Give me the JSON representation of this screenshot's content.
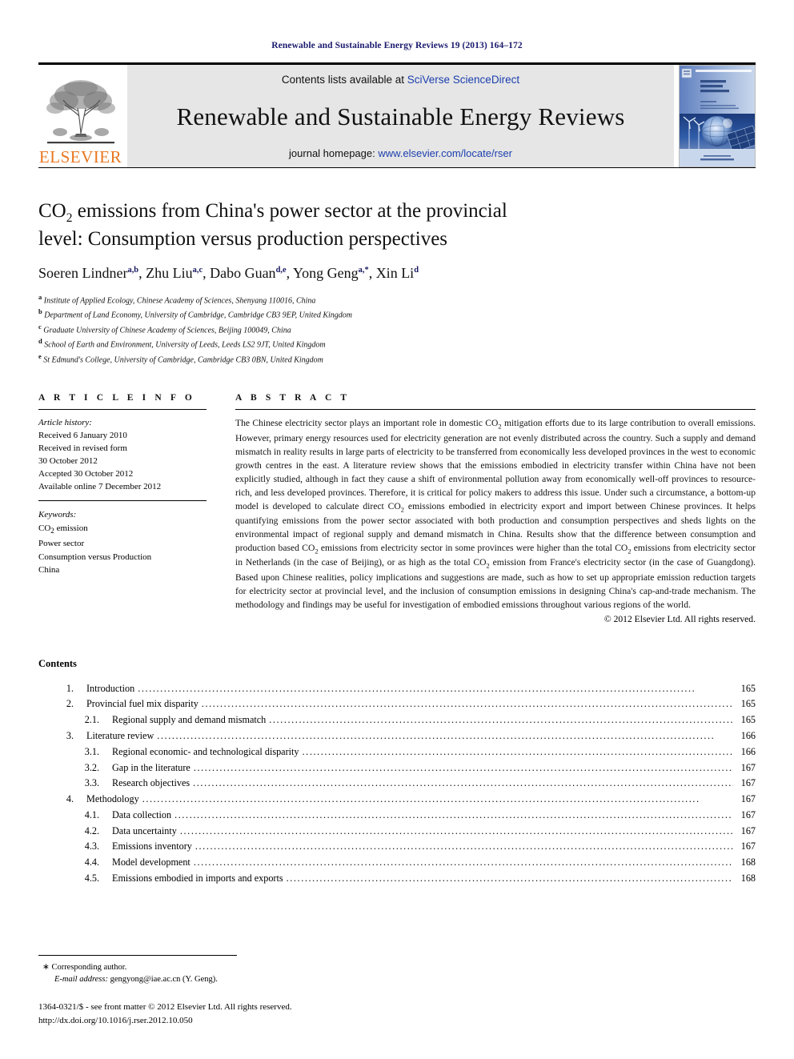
{
  "running_head": "Renewable and Sustainable Energy Reviews 19 (2013) 164–172",
  "masthead": {
    "contents_prefix": "Contents lists available at ",
    "sciencedirect_link": "SciVerse ScienceDirect",
    "journal_title": "Renewable and Sustainable Energy Reviews",
    "homepage_prefix": "journal homepage: ",
    "homepage_link": "www.elsevier.com/locate/rser",
    "publisher_word": "ELSEVIER",
    "cover_title_lines": [
      "Renewable &",
      "Sustainable",
      "Energy Reviews"
    ],
    "colors": {
      "link_blue": "#1b3fae",
      "elsevier_orange": "#E87722",
      "banner_gray": "#e6e6e6",
      "running_head_navy": "#1a1a6e"
    }
  },
  "article": {
    "title_line1_a": "CO",
    "title_line1_sub": "2",
    "title_line1_b": " emissions from China's power sector at the provincial",
    "title_line2": "level: Consumption versus production perspectives",
    "authors": [
      {
        "name": "Soeren Lindner",
        "sup": "a,b"
      },
      {
        "name": "Zhu Liu",
        "sup": "a,c"
      },
      {
        "name": "Dabo Guan",
        "sup": "d,e"
      },
      {
        "name": "Yong Geng",
        "sup": "a,*"
      },
      {
        "name": "Xin Li",
        "sup": "d"
      }
    ],
    "affiliations": [
      {
        "mark": "a",
        "text": "Institute of Applied Ecology, Chinese Academy of Sciences, Shenyang 110016, China"
      },
      {
        "mark": "b",
        "text": "Department of Land Economy, University of Cambridge, Cambridge CB3 9EP, United Kingdom"
      },
      {
        "mark": "c",
        "text": "Graduate University of Chinese Academy of Sciences, Beijing 100049, China"
      },
      {
        "mark": "d",
        "text": "School of Earth and Environment, University of Leeds, Leeds LS2 9JT, United Kingdom"
      },
      {
        "mark": "e",
        "text": "St Edmund's College, University of Cambridge, Cambridge CB3 0BN, United Kingdom"
      }
    ]
  },
  "article_info": {
    "heading": "A R T I C L E   I N F O",
    "history_label": "Article history:",
    "history": [
      "Received 6 January 2010",
      "Received in revised form",
      "30 October 2012",
      "Accepted 30 October 2012",
      "Available online 7 December 2012"
    ],
    "keywords_label": "Keywords:",
    "keywords": [
      "CO2 emission",
      "Power sector",
      "Consumption versus Production",
      "China"
    ],
    "keyword_first_a": "CO",
    "keyword_first_sub": "2",
    "keyword_first_b": " emission"
  },
  "abstract": {
    "heading": "A B S T R A C T",
    "paragraph_part1": "The Chinese electricity sector plays an important role in domestic CO",
    "sub1": "2",
    "paragraph_part2": " mitigation efforts due to its large contribution to overall emissions. However, primary energy resources used for electricity generation are not evenly distributed across the country. Such a supply and demand mismatch in reality results in large parts of electricity to be transferred from economically less developed provinces in the west to economic growth centres in the east. A literature review shows that the emissions embodied in electricity transfer within China have not been explicitly studied, although in fact they cause a shift of environmental pollution away from economically well-off provinces to resource-rich, and less developed provinces. Therefore, it is critical for policy makers to address this issue. Under such a circumstance, a bottom-up model is developed to calculate direct CO",
    "sub2": "2",
    "paragraph_part3": " emissions embodied in electricity export and import between Chinese provinces. It helps quantifying emissions from the power sector associated with both production and consumption perspectives and sheds lights on the environmental impact of regional supply and demand mismatch in China. Results show that the difference between consumption and production based CO",
    "sub3": "2",
    "paragraph_part4": " emissions from electricity sector in some provinces were higher than the total CO",
    "sub4": "2",
    "paragraph_part5": " emissions from electricity sector in Netherlands (in the case of Beijing), or as high as the total CO",
    "sub5": "2",
    "paragraph_part6": " emission from France's electricity sector (in the case of Guangdong). Based upon Chinese realities, policy implications and suggestions are made, such as how to set up appropriate emission reduction targets for electricity sector at provincial level, and the inclusion of consumption emissions in designing China's cap-and-trade mechanism. The methodology and findings may be useful for investigation of embodied emissions throughout various regions of the world.",
    "copyright": "© 2012 Elsevier Ltd. All rights reserved."
  },
  "contents": {
    "heading": "Contents",
    "items": [
      {
        "num": "1.",
        "level": 1,
        "label": "Introduction",
        "page": "165"
      },
      {
        "num": "2.",
        "level": 1,
        "label": "Provincial fuel mix disparity",
        "page": "165"
      },
      {
        "num": "2.1.",
        "level": 2,
        "label": "Regional supply and demand mismatch",
        "page": "165"
      },
      {
        "num": "3.",
        "level": 1,
        "label": "Literature review",
        "page": "166"
      },
      {
        "num": "3.1.",
        "level": 2,
        "label": "Regional economic- and technological disparity",
        "page": "166"
      },
      {
        "num": "3.2.",
        "level": 2,
        "label": "Gap in the literature",
        "page": "167"
      },
      {
        "num": "3.3.",
        "level": 2,
        "label": "Research objectives",
        "page": "167"
      },
      {
        "num": "4.",
        "level": 1,
        "label": "Methodology",
        "page": "167"
      },
      {
        "num": "4.1.",
        "level": 2,
        "label": "Data collection",
        "page": "167"
      },
      {
        "num": "4.2.",
        "level": 2,
        "label": "Data uncertainty",
        "page": "167"
      },
      {
        "num": "4.3.",
        "level": 2,
        "label": "Emissions inventory",
        "page": "167"
      },
      {
        "num": "4.4.",
        "level": 2,
        "label": "Model development",
        "page": "168"
      },
      {
        "num": "4.5.",
        "level": 2,
        "label": "Emissions embodied in imports and exports",
        "page": "168"
      }
    ]
  },
  "footer": {
    "corresponding_author": "Corresponding author.",
    "email_label": "E-mail address:",
    "email_value": " gengyong@iae.ac.cn (Y. Geng).",
    "issn_line": "1364-0321/$ - see front matter © 2012 Elsevier Ltd. All rights reserved.",
    "doi_line": "http://dx.doi.org/10.1016/j.rser.2012.10.050"
  }
}
